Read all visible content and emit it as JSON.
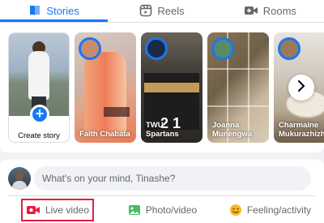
{
  "tabs": [
    {
      "label": "Stories",
      "icon": "book-open-icon",
      "active": true
    },
    {
      "label": "Reels",
      "icon": "reels-icon",
      "active": false
    },
    {
      "label": "Rooms",
      "icon": "video-camera-plus-icon",
      "active": false
    }
  ],
  "stories": {
    "create_label": "Create story",
    "items": [
      {
        "name": "Faith Chabata"
      },
      {
        "name": "TWU Spartans"
      },
      {
        "name": "Joanna Munengwa"
      },
      {
        "name": "Charmaine Mukurazhizha"
      }
    ]
  },
  "composer": {
    "placeholder": "What's on your mind, Tinashe?",
    "actions": [
      {
        "label": "Live video",
        "icon": "live-video-icon",
        "color": "#e41e3f",
        "highlighted": true
      },
      {
        "label": "Photo/video",
        "icon": "photo-icon",
        "color": "#45bd62"
      },
      {
        "label": "Feeling/activity",
        "icon": "smiley-icon",
        "color": "#f7b928"
      }
    ]
  },
  "colors": {
    "accent": "#1877f2",
    "live": "#e41e3f",
    "photo": "#45bd62",
    "feeling": "#f7b928"
  }
}
